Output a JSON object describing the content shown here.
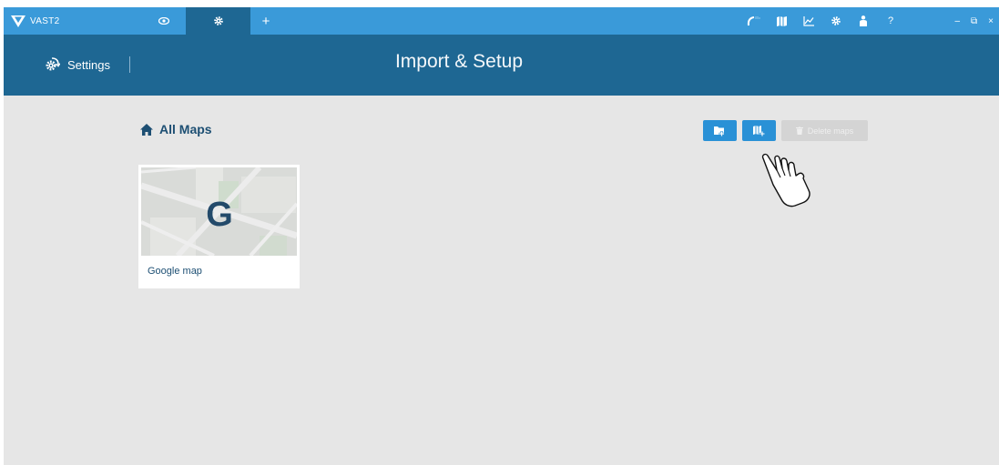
{
  "app": {
    "name": "VAST2"
  },
  "tabs": [
    {
      "icon": "eye-icon"
    },
    {
      "icon": "gear-icon",
      "active": true
    },
    {
      "icon": "plus-icon",
      "label": "+"
    }
  ],
  "toolbar_icons": [
    "magnet-icon",
    "map-icon",
    "chart-icon",
    "gear-icon",
    "person-icon",
    "help-icon"
  ],
  "help_label": "?",
  "window_controls": {
    "minimize": "–",
    "restore": "⧉",
    "close": "×"
  },
  "header": {
    "settings_label": "Settings",
    "title": "Import & Setup"
  },
  "breadcrumb": {
    "label": "All Maps"
  },
  "actions": {
    "delete_label": "Delete maps"
  },
  "maps": [
    {
      "label": "Google map",
      "thumbnail_letter": "G"
    }
  ],
  "colors": {
    "titlebar": "#3a9ad9",
    "header": "#1e6793",
    "content_bg": "#e6e6e6",
    "accent": "#2a91d6",
    "text_dark": "#1d4f73"
  }
}
